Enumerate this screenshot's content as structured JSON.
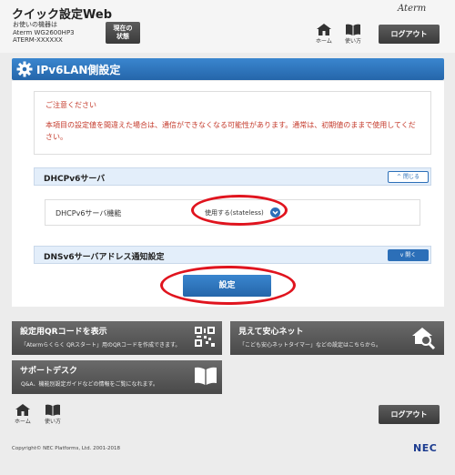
{
  "header": {
    "app_title": "クイック設定Web",
    "device_label": "お使いの機器は",
    "device_model": "Aterm WG2600HP3",
    "device_name": "ATERM-XXXXXX",
    "status_button": "現在の状態",
    "brand": "Aterm",
    "home_label": "ホーム",
    "manual_label": "使い方",
    "logout_label": "ログアウト"
  },
  "page": {
    "title": "IPv6LAN側設定"
  },
  "notice": {
    "title": "ご注意ください",
    "body": "本項目の設定値を間違えた場合は、通信ができなくなる可能性があります。通常は、初期値のままで使用してください。"
  },
  "dhcp_section": {
    "title": "DHCPv6サーバ",
    "toggle_label": "閉じる",
    "field_label": "DHCPv6サーバ機能",
    "field_value": "使用する(stateless)"
  },
  "dns_section": {
    "title": "DNSv6サーバアドレス通知設定",
    "toggle_label": "開く"
  },
  "apply_button": "設定",
  "tiles": [
    {
      "title": "設定用QRコードを表示",
      "desc": "「Atermらくらく QRスタート」用のQRコードを作成できます。",
      "icon": "qr-code-icon"
    },
    {
      "title": "見えて安心ネット",
      "desc": "「こども安心ネットタイマー」などの設定はこちらから。",
      "icon": "house-search-icon"
    },
    {
      "title": "サポートデスク",
      "desc": "Q&A、機能別設定ガイドなどの情報をご覧になれます。",
      "icon": "book-icon"
    }
  ],
  "footer": {
    "home_label": "ホーム",
    "manual_label": "使い方",
    "logout_label": "ログアウト",
    "copyright": "Copyright© NEC Platforms, Ltd. 2001-2018",
    "logo": "NEC"
  },
  "colors": {
    "accent_blue": "#2c6fb8",
    "notice_red": "#c43a2b",
    "highlight_ring": "#e0141e",
    "dark_button": "#494949"
  }
}
